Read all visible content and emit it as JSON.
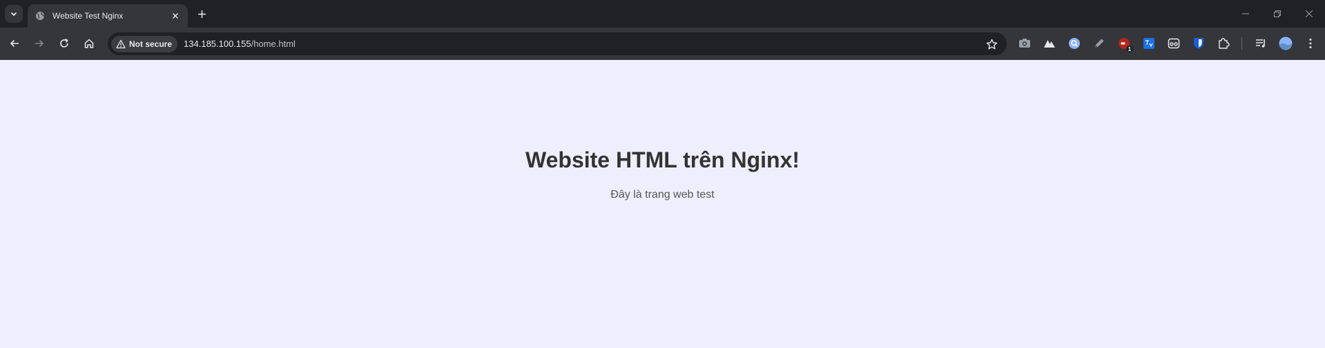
{
  "browser": {
    "tab": {
      "title": "Website Test Nginx"
    },
    "security_label": "Not secure",
    "url_host": "134.185.100.155",
    "url_path": "/home.html",
    "extension_badge": "1"
  },
  "page": {
    "heading": "Website HTML trên Nginx!",
    "subtext": "Đây là trang web test"
  },
  "colors": {
    "page_background": "#efeefc",
    "heading": "#333333",
    "subtext": "#555555",
    "chrome_frame": "#202124",
    "chrome_toolbar": "#35363a"
  },
  "icons": [
    "tab-search-icon",
    "globe-icon",
    "close-icon",
    "plus-icon",
    "back-arrow-icon",
    "forward-arrow-icon",
    "reload-icon",
    "home-icon",
    "warning-icon",
    "star-icon",
    "camera-icon",
    "mountain-icon",
    "lens-icon",
    "pen-icon",
    "record-icon",
    "translate-icon",
    "reader-icon",
    "bitwarden-icon",
    "puzzle-icon",
    "media-controls-icon",
    "avatar",
    "menu-icon",
    "minimize-icon",
    "restore-icon"
  ]
}
